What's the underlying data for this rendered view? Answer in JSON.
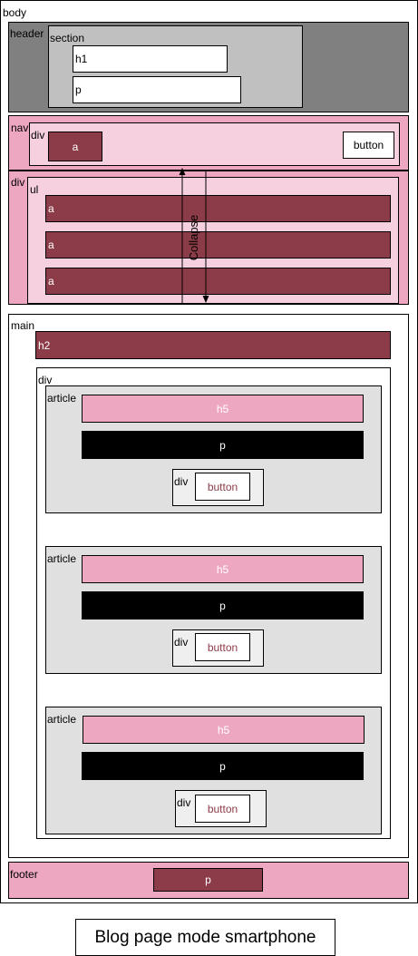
{
  "labels": {
    "body": "body",
    "header": "header",
    "section": "section",
    "h1": "h1",
    "p": "p",
    "nav": "nav",
    "div": "div",
    "a": "a",
    "button": "button",
    "ul": "ul",
    "main": "main",
    "h2": "h2",
    "article": "article",
    "h5": "h5",
    "footer": "footer",
    "collapse": "Collapse"
  },
  "caption": "Blog page mode smartphone",
  "colors": {
    "maroon": "#8c3b48",
    "pink": "#eea7c1",
    "light_pink": "#f7d0df",
    "header_gray": "#808080",
    "section_gray": "#c0c0c0",
    "article_gray": "#e0e0e0"
  }
}
